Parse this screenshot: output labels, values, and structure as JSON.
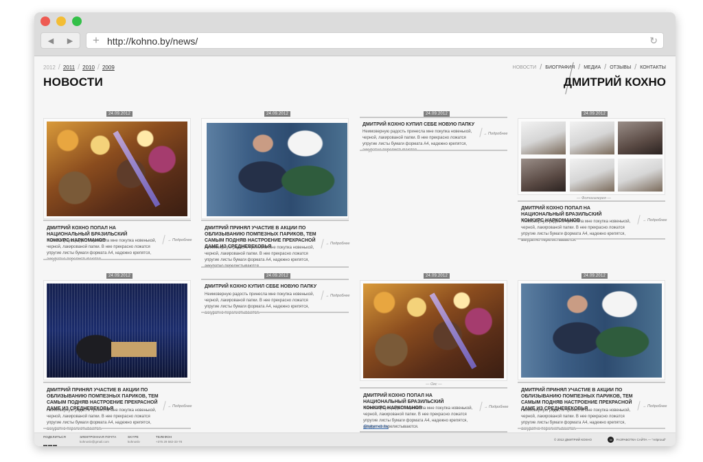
{
  "browser": {
    "url": "http://kohno.by/news/",
    "back_icon": "back-arrow-icon",
    "forward_icon": "forward-arrow-icon",
    "new_tab_icon": "plus-icon",
    "reload_icon": "reload-icon"
  },
  "header": {
    "years": [
      "2012",
      "2011",
      "2010",
      "2009"
    ],
    "title": "НОВОСТИ",
    "nav": [
      "НОВОСТИ",
      "БИОГРАФИЯ",
      "МЕДИА",
      "ОТЗЫВЫ",
      "КОНТАКТЫ"
    ],
    "site_name": "ДМИТРИЙ КОХНО"
  },
  "cards": [
    {
      "date": "24.09.2012",
      "title": "ДМИТРИЙ КОХНО ПОПАЛ НА НАЦИОНАЛЬНЫЙ БРАЗИЛЬСКИЙ КОНКУРС НАРКОМАНОВ",
      "text": "Неимоверную радость принесла мне покупка новенькой, черной, лакированой папки. В нее прекрасно ложатся упругие листы бумаги формата А4, надежно крепятся, аккуратно перелистываются.",
      "more": "Подробнее"
    },
    {
      "date": "24.09.2012",
      "title": "ДМИТРИЙ ПРИНЯЛ УЧАСТИЕ В АКЦИИ ПО ОБЛИЗЫВАНИЮ ПОМПЕЗНЫХ ПАРИКОВ, ТЕМ САМЫМ ПОДНЯВ НАСТРОЕНИЕ ПРЕКРАСНОЙ ДАМЕ ИЗ СРЕДНЕВЕКОВЬЯ",
      "text": "Неимоверную радость принесла мне покупка новенькой, черной, лакированой папки. В нее прекрасно ложатся упругие листы бумаги формата А4, надежно крепятся, аккуратно перелистываются.",
      "more": "Подробнее"
    },
    {
      "date": "24.09.2012",
      "title": "ДМИТРИЙ КОХНО КУПИЛ СЕБЕ НОВУЮ ПАПКУ",
      "text": "Неимоверную радость принесла мне покупка новенькой, черной, лакированой папки. В нее прекрасно ложатся упругие листы бумаги формата А4, надежно крепятся, аккуратно перелистываются.",
      "more": "Подробнее"
    },
    {
      "date": "24.09.2012",
      "caption": "Фотогалерея",
      "title": "ДМИТРИЙ КОХНО ПОПАЛ НА НАЦИОНАЛЬНЫЙ БРАЗИЛЬСКИЙ КОНКУРС НАРКОМАНОВ",
      "text": "Неимоверную радость принесла мне покупка новенькой, черной, лакированой папки. В нее прекрасно ложатся упругие листы бумаги формата А4, надежно крепятся, аккуратно перелистываются.",
      "more": "Подробнее"
    },
    {
      "date": "24.09.2012",
      "title": "ДМИТРИЙ ПРИНЯЛ УЧАСТИЕ В АКЦИИ ПО ОБЛИЗЫВАНИЮ ПОМПЕЗНЫХ ПАРИКОВ, ТЕМ САМЫМ ПОДНЯВ НАСТРОЕНИЕ ПРЕКРАСНОЙ ДАМЕ ИЗ СРЕДНЕВЕКОВЬЯ",
      "text": "Неимоверную радость принесла мне покупка новенькой, черной, лакированой папки. В нее прекрасно ложатся упругие листы бумаги формата А4, надежно крепятся, аккуратно перелистываются.",
      "more": "Подробнее"
    },
    {
      "date": "24.09.2012",
      "title": "ДМИТРИЙ КОХНО КУПИЛ СЕБЕ НОВУЮ ПАПКУ",
      "text": "Неимоверную радость принесла мне покупка новенькой, черной, лакированой папки. В нее прекрасно ложатся упругие листы бумаги формата А4, надежно крепятся, аккуратно перелистываются.",
      "more": "Подробнее"
    },
    {
      "date": "24.09.2012",
      "caption": "Окс",
      "title": "ДМИТРИЙ КОХНО ПОПАЛ НА НАЦИОНАЛЬНЫЙ БРАЗИЛЬСКИЙ КОНКУРС НАРКОМАНОВ",
      "text": "Неимоверную радость принесла мне покупка новенькой, черной, лакированой папки. В нее прекрасно ложатся упругие листы бумаги формата А4, надежно крепятся, аккуратно перелистываются.",
      "more": "Подробнее",
      "tag": "@tukymob.by"
    },
    {
      "date": "24.09.2012",
      "title": "ДМИТРИЙ ПРИНЯЛ УЧАСТИЕ В АКЦИИ ПО ОБЛИЗЫВАНИЮ ПОМПЕЗНЫХ ПАРИКОВ, ТЕМ САМЫМ ПОДНЯВ НАСТРОЕНИЕ ПРЕКРАСНОЙ ДАМЕ ИЗ СРЕДНЕВЕКОВЬЯ",
      "text": "Неимоверную радость принесла мне покупка новенькой, черной, лакированой папки. В нее прекрасно ложатся упругие листы бумаги формата А4, надежно крепятся, аккуратно перелистываются.",
      "more": "Подробнее"
    }
  ],
  "footer": {
    "social_label": "ПОДЕЛИТЬСЯ",
    "social_icons": [
      "f",
      "t",
      "in"
    ],
    "email_label": "ЭЛЕКТРОННАЯ ПОЧТА",
    "email": "kohnoslv@gmail.com",
    "skype_label": "SKYPE",
    "skype": "kohnoslv",
    "phone_label": "ТЕЛЕФОН",
    "phone": "+375 29 582-33-78",
    "copyright": "© 2012 ДМИТРИЙ КОХНО",
    "dev_label": "РАЗРАБОТКА САЙТА — \"Artproud\""
  }
}
